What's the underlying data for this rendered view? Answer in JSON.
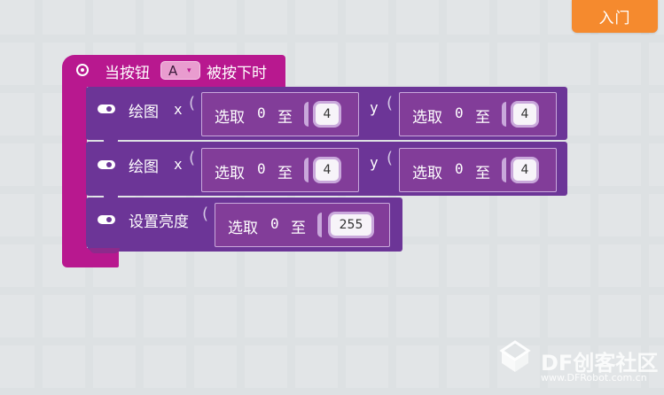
{
  "toolbar": {
    "entry_label": "入门"
  },
  "hat_block": {
    "prefix": "当按钮",
    "button_value": "A",
    "dropdown_arrow": "▾",
    "suffix": "被按下时",
    "color": "#b8188f"
  },
  "statements": [
    {
      "label": "绘图",
      "args": [
        {
          "name": "x",
          "rand_label": "选取",
          "from": "0",
          "to_word": "至",
          "to": "4"
        },
        {
          "name": "y",
          "rand_label": "选取",
          "from": "0",
          "to_word": "至",
          "to": "4"
        }
      ]
    },
    {
      "label": "绘图",
      "args": [
        {
          "name": "x",
          "rand_label": "选取",
          "from": "0",
          "to_word": "至",
          "to": "4"
        },
        {
          "name": "y",
          "rand_label": "选取",
          "from": "0",
          "to_word": "至",
          "to": "4"
        }
      ]
    },
    {
      "label": "设置亮度",
      "args": [
        {
          "name": "",
          "rand_label": "选取",
          "from": "0",
          "to_word": "至",
          "to": "255"
        }
      ]
    }
  ],
  "colors": {
    "statement": "#6c3597",
    "random_block": "#823d99",
    "entry_button": "#f58a2e",
    "background": "#eef0f1"
  },
  "watermark": {
    "main": "DF创客社区",
    "sub": "www.DFRobot.com.cn"
  }
}
